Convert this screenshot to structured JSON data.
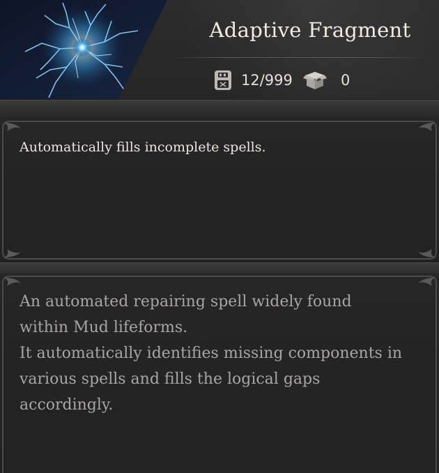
{
  "item": {
    "name": "Adaptive Fragment",
    "icon": "crackling-blue-orb-icon",
    "description": "Automatically fills incomplete spells.",
    "lore": "An automated repairing spell widely found\nwithin Mud lifeforms.\nIt automatically identifies missing components in\nvarious spells and fills the logical gaps\naccordingly."
  },
  "stats": {
    "storage": {
      "icon": "storage-drive-icon",
      "value": "12/999"
    },
    "stash": {
      "icon": "box-icon",
      "value": "0"
    }
  },
  "colors": {
    "background": "#1b1b1b",
    "title": "#f1ece2",
    "description": "#ece7de",
    "lore": "#a9a6a1",
    "orb_glow": "#7fd4ff"
  }
}
